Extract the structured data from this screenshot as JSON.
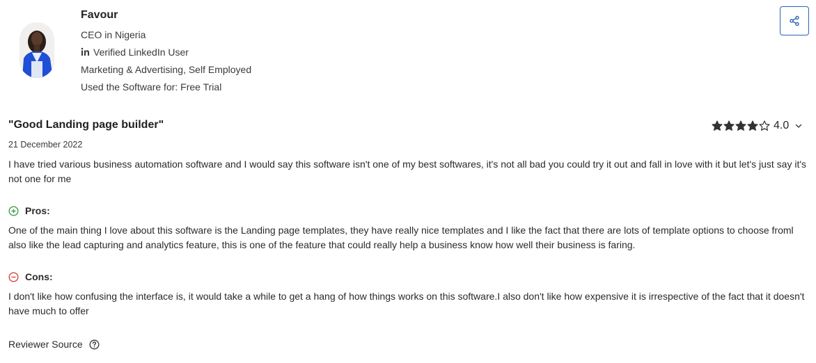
{
  "reviewer": {
    "name": "Favour",
    "role": "CEO in Nigeria",
    "verification": "Verified LinkedIn User",
    "industry": "Marketing & Advertising, Self Employed",
    "usage": "Used the Software for: Free Trial"
  },
  "review": {
    "title": "\"Good Landing page builder\"",
    "rating": "4.0",
    "stars_filled": 4,
    "stars_total": 5,
    "date": "21 December 2022",
    "summary": "I have tried various business automation software and I would say this software isn't one of my best softwares, it's not all bad you could try it out and fall in love with it but let's just say it's not one for me",
    "pros_label": "Pros:",
    "pros": "One of the main thing I love about this software is the Landing page templates, they have really nice templates and I like the fact that there are lots of template options to choose froml also like the lead capturing and analytics feature, this is one of the feature that could really help a business know how well their business is faring.",
    "cons_label": "Cons:",
    "cons": "I don't like how confusing the interface is, it would take a while to get a hang of how things works on this software.I also don't like how expensive it is irrespective of the fact that it doesn't have much to offer"
  },
  "footer": {
    "source_label": "Reviewer Source"
  },
  "colors": {
    "accent": "#2b63b7",
    "pros": "#3aa14a",
    "cons": "#d9453d",
    "star": "#333333"
  },
  "icons": {
    "share": "share-icon",
    "linkedin": "linkedin-icon",
    "star": "star-icon",
    "chevron": "chevron-down-icon",
    "pros": "plus-circle-icon",
    "cons": "minus-circle-icon",
    "help": "question-circle-icon"
  }
}
